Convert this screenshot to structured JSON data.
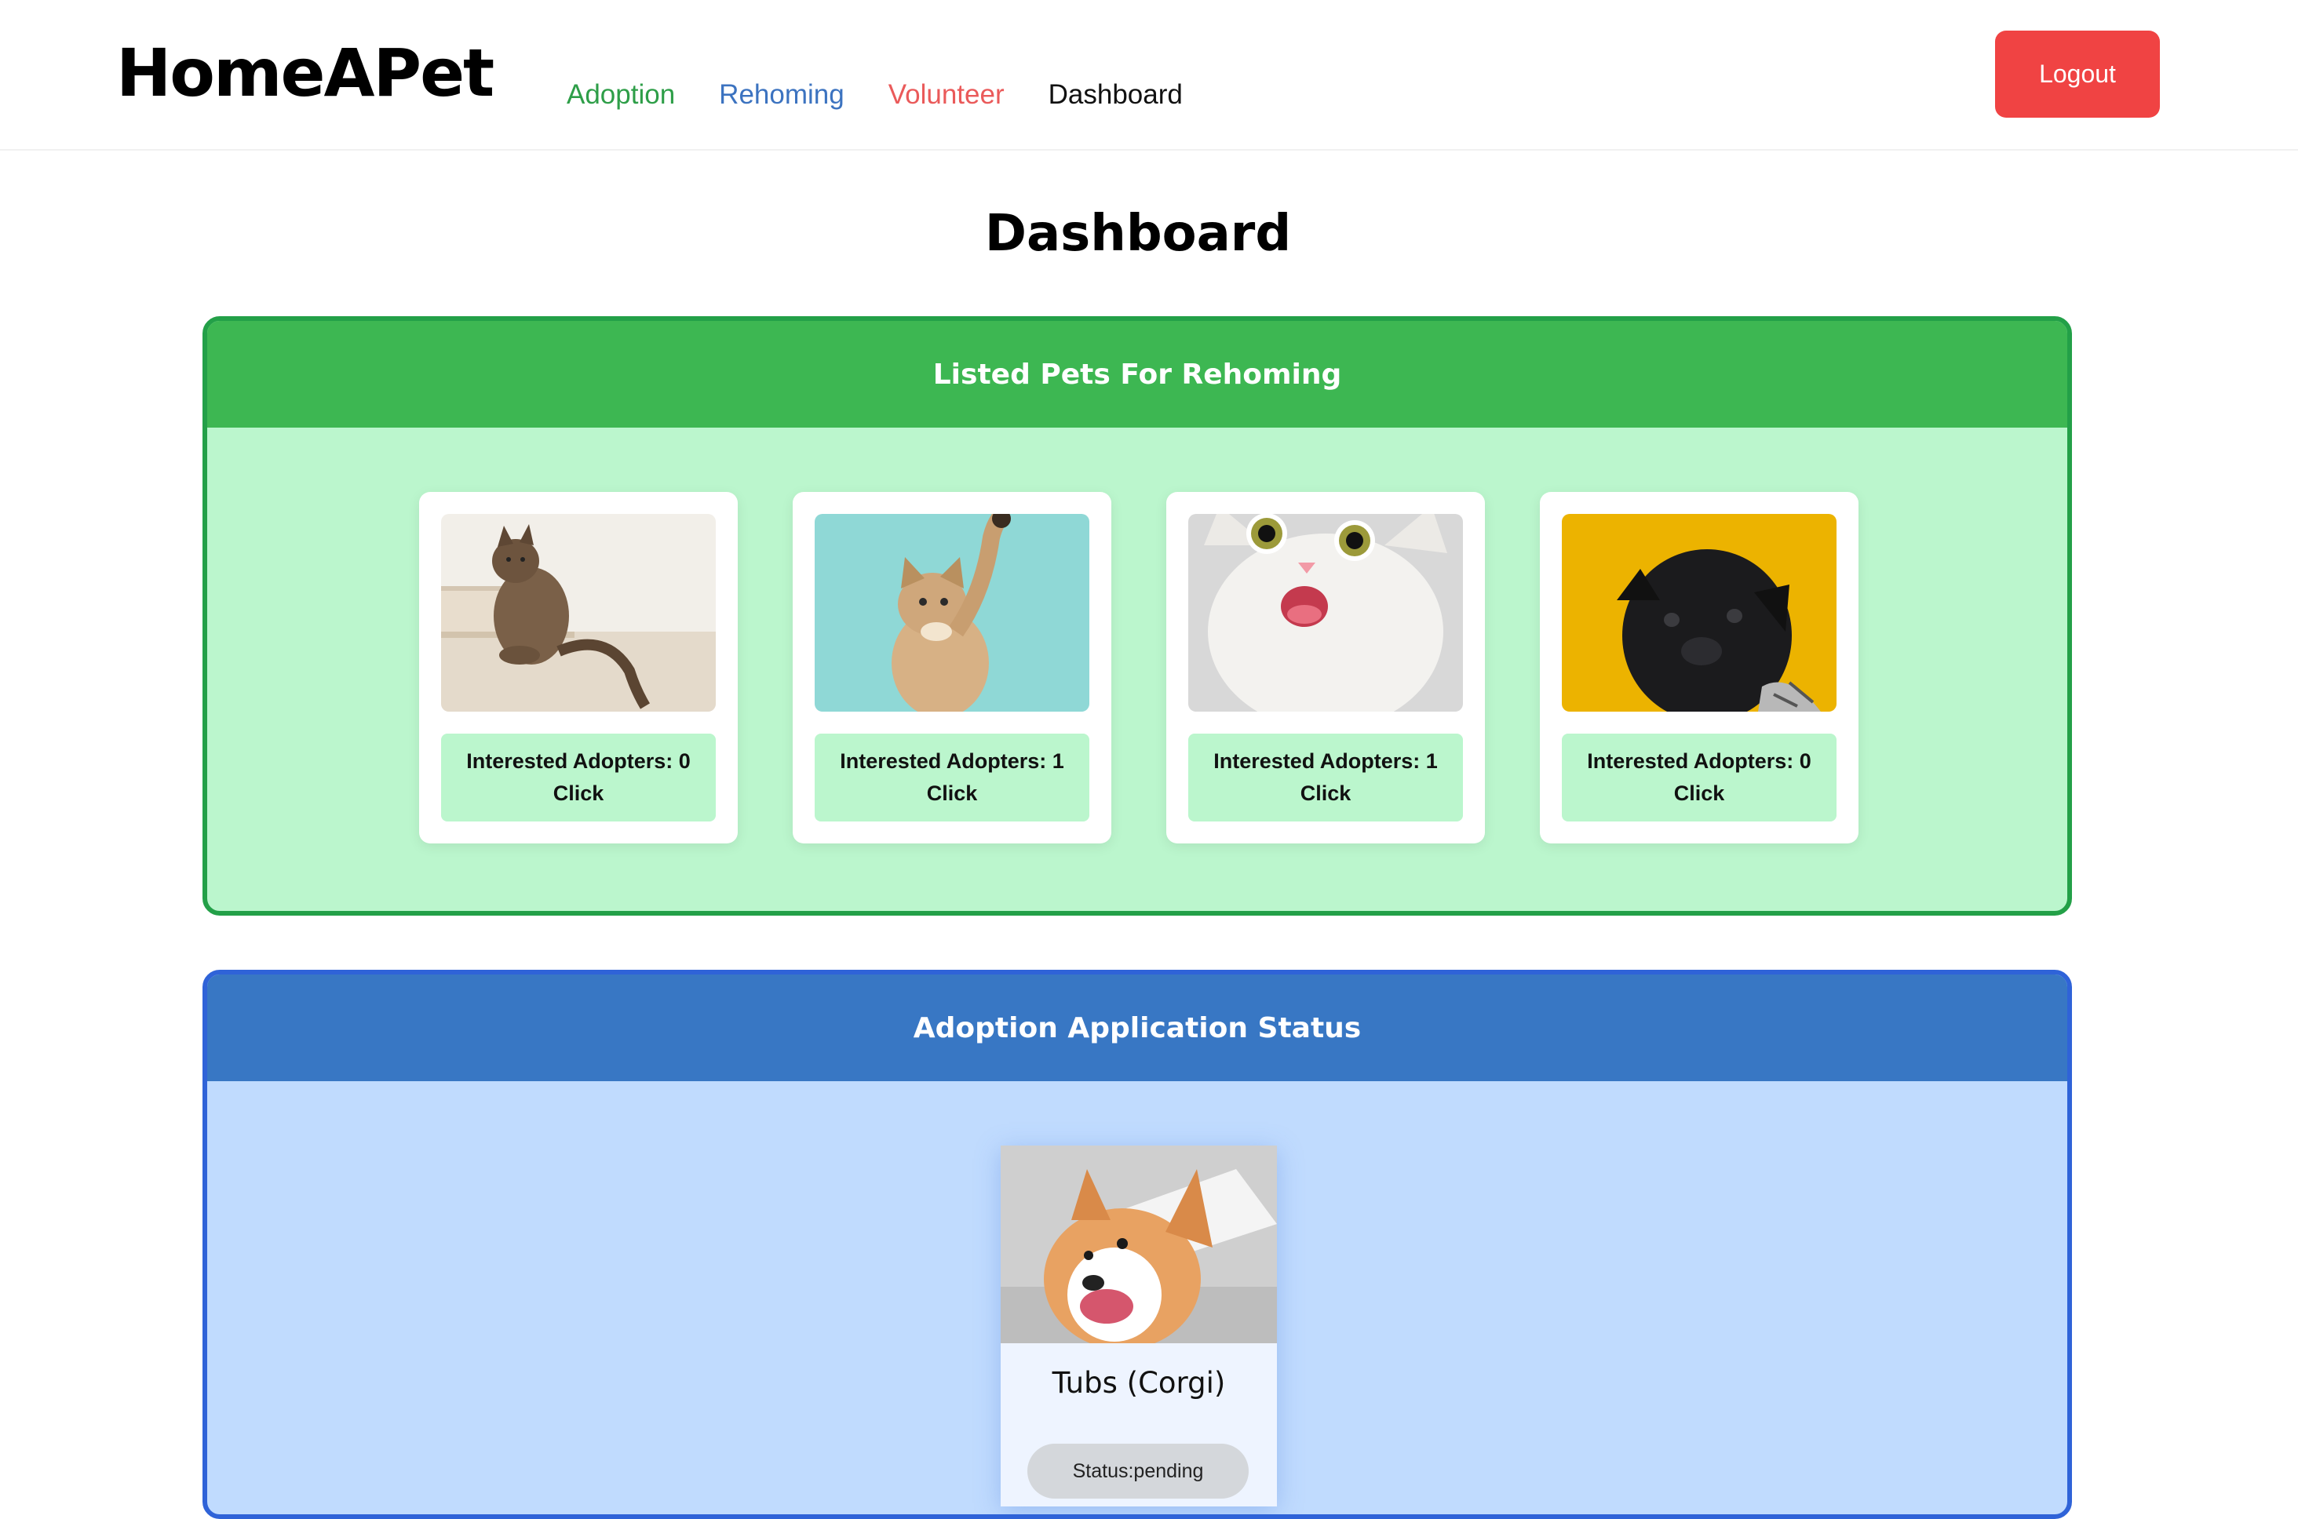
{
  "brand": "HomeAPet",
  "nav": {
    "adoption": "Adoption",
    "rehoming": "Rehoming",
    "volunteer": "Volunteer",
    "dashboard": "Dashboard"
  },
  "logout_label": "Logout",
  "page_title": "Dashboard",
  "rehoming_panel": {
    "title": "Listed Pets For Rehoming",
    "pets": [
      {
        "adopters_text": "Interested Adopters: 0",
        "action": "Click",
        "photo": "tabby-cat-on-stairs"
      },
      {
        "adopters_text": "Interested Adopters: 1",
        "action": "Click",
        "photo": "kitten-reaching-up"
      },
      {
        "adopters_text": "Interested Adopters: 1",
        "action": "Click",
        "photo": "surprised-white-cat"
      },
      {
        "adopters_text": "Interested Adopters: 0",
        "action": "Click",
        "photo": "black-pug"
      }
    ]
  },
  "adoption_panel": {
    "title": "Adoption Application Status",
    "application": {
      "name": "Tubs (Corgi)",
      "status": "Status:pending",
      "photo": "corgi"
    }
  },
  "colors": {
    "green_accent": "#3db752",
    "green_bg": "#bbf6cd",
    "blue_accent": "#3877c4",
    "blue_bg": "#c0dbfe",
    "logout_red": "#f04343"
  }
}
